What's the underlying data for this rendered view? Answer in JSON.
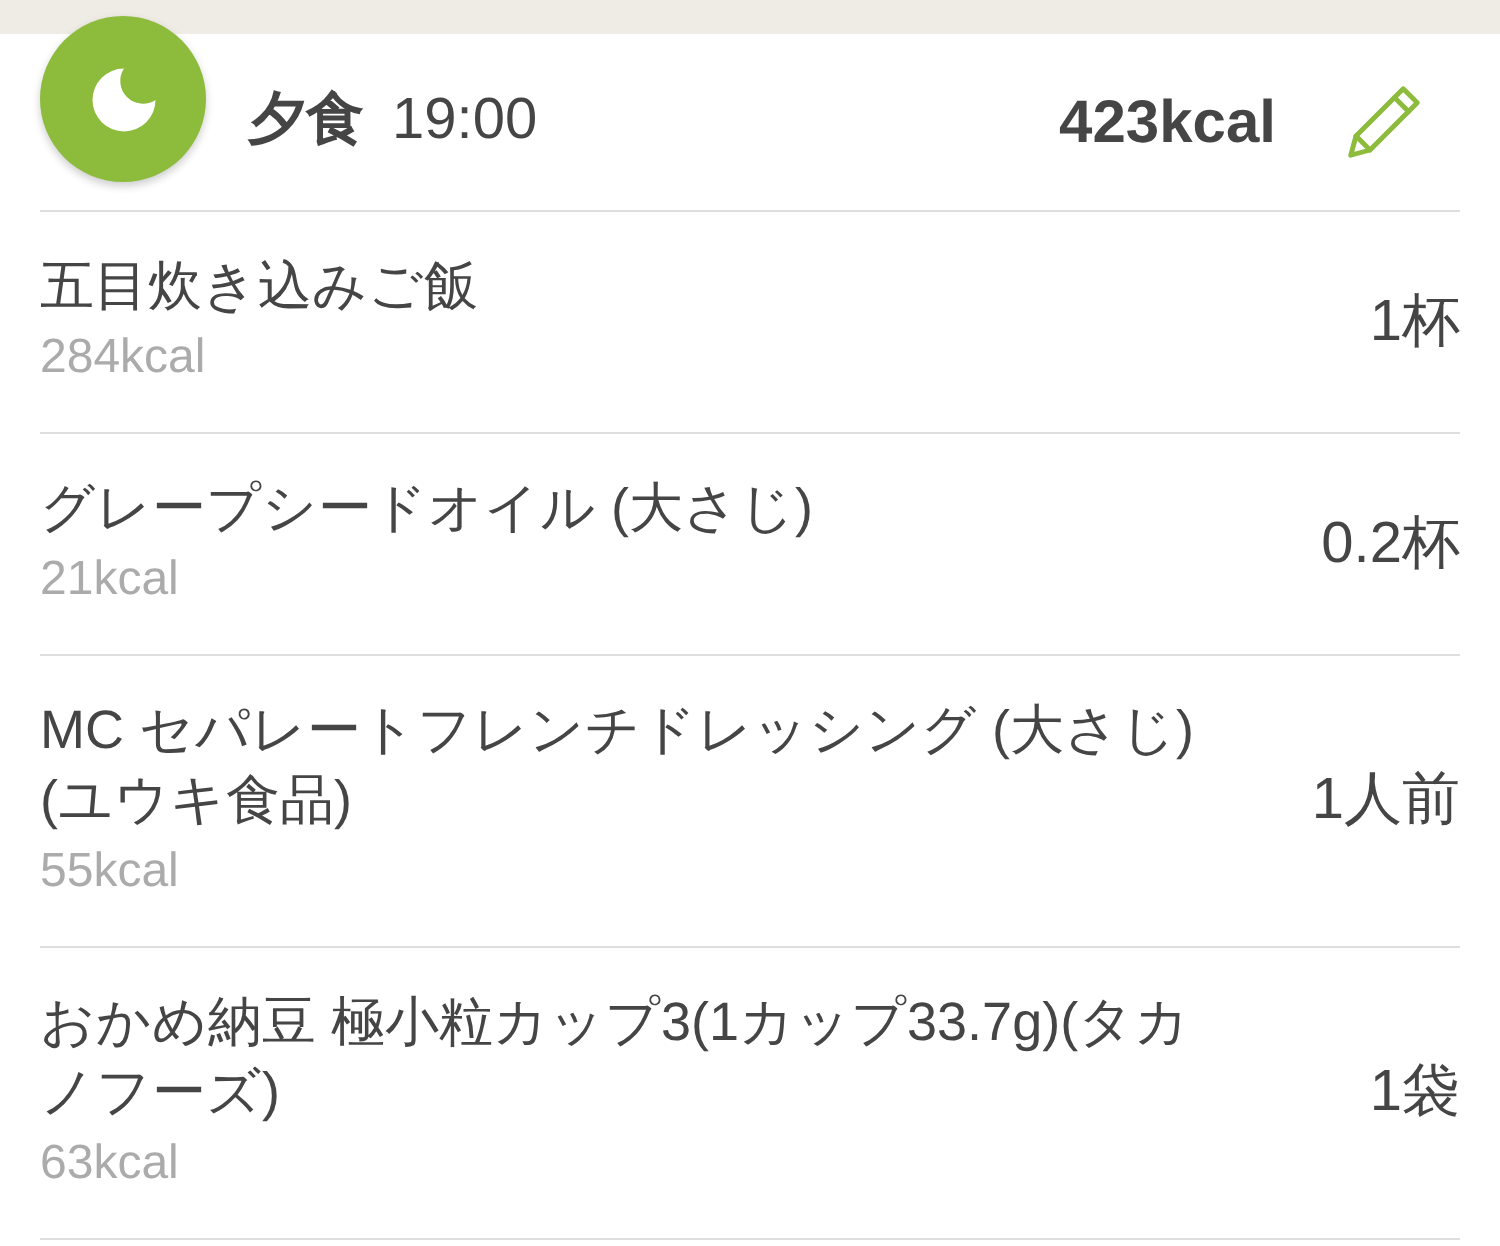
{
  "meal": {
    "name": "夕食",
    "time": "19:00",
    "total": "423kcal"
  },
  "items": [
    {
      "name": "五目炊き込みご飯",
      "kcal": "284kcal",
      "amount": "1杯"
    },
    {
      "name": "グレープシードオイル (大さじ)",
      "kcal": "21kcal",
      "amount": "0.2杯"
    },
    {
      "name": "MC セパレートフレンチドレッシング (大さじ)(ユウキ食品)",
      "kcal": "55kcal",
      "amount": "1人前"
    },
    {
      "name": "おかめ納豆 極小粒カップ3(1カップ33.7g)(タカノフーズ)",
      "kcal": "63kcal",
      "amount": "1袋"
    }
  ]
}
